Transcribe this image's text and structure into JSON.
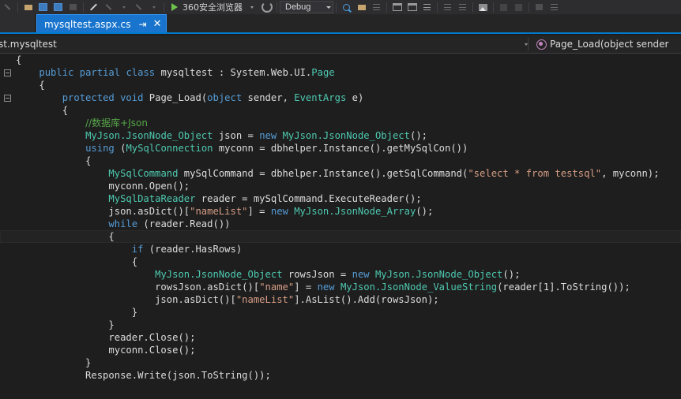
{
  "toolbar": {
    "browser_label": "360安全浏览器",
    "config_label": "Debug",
    "icons": [
      "open-folder-icon",
      "new-window-icon",
      "save-icon",
      "undo-icon",
      "redo-icon",
      "run-icon",
      "stop-icon",
      "find-icon",
      "comment-icon",
      "uncomment-icon",
      "indent-icon",
      "outdent-icon",
      "image-icon",
      "bar-icon",
      "list-icon"
    ]
  },
  "tab": {
    "title": "mysqltest.aspx.cs",
    "pin_glyph": "⇥",
    "close_glyph": "✕"
  },
  "navbar": {
    "left_text": "st.mysqltest",
    "right_text": "Page_Load(object sender"
  },
  "editor": {
    "lines": [
      {
        "indent": 0,
        "fold": null,
        "current": false,
        "tokens": [
          {
            "t": "{",
            "c": "pl"
          }
        ]
      },
      {
        "indent": 0,
        "fold": "minus",
        "current": false,
        "tokens": [
          {
            "t": "    ",
            "c": "pl"
          },
          {
            "t": "public",
            "c": "kw"
          },
          {
            "t": " ",
            "c": "pl"
          },
          {
            "t": "partial",
            "c": "kw"
          },
          {
            "t": " ",
            "c": "pl"
          },
          {
            "t": "class",
            "c": "kw"
          },
          {
            "t": " mysqltest : System.Web.UI.",
            "c": "pl"
          },
          {
            "t": "Page",
            "c": "typ"
          }
        ]
      },
      {
        "indent": 0,
        "fold": null,
        "current": false,
        "tokens": [
          {
            "t": "    {",
            "c": "pl"
          }
        ]
      },
      {
        "indent": 0,
        "fold": "minus",
        "current": false,
        "tokens": [
          {
            "t": "        ",
            "c": "pl"
          },
          {
            "t": "protected",
            "c": "kw"
          },
          {
            "t": " ",
            "c": "pl"
          },
          {
            "t": "void",
            "c": "kw"
          },
          {
            "t": " Page_Load(",
            "c": "pl"
          },
          {
            "t": "object",
            "c": "kw"
          },
          {
            "t": " sender, ",
            "c": "pl"
          },
          {
            "t": "EventArgs",
            "c": "typ"
          },
          {
            "t": " e)",
            "c": "pl"
          }
        ]
      },
      {
        "indent": 0,
        "fold": null,
        "current": false,
        "tokens": [
          {
            "t": "        {",
            "c": "pl"
          }
        ]
      },
      {
        "indent": 0,
        "fold": null,
        "current": false,
        "tokens": [
          {
            "t": "            ",
            "c": "pl"
          },
          {
            "t": "//数据库+Json",
            "c": "cm"
          }
        ]
      },
      {
        "indent": 0,
        "fold": null,
        "current": false,
        "tokens": [
          {
            "t": "            ",
            "c": "pl"
          },
          {
            "t": "MyJson.JsonNode_Object",
            "c": "typ"
          },
          {
            "t": " json = ",
            "c": "pl"
          },
          {
            "t": "new",
            "c": "kw"
          },
          {
            "t": " ",
            "c": "pl"
          },
          {
            "t": "MyJson.JsonNode_Object",
            "c": "typ"
          },
          {
            "t": "();",
            "c": "pl"
          }
        ]
      },
      {
        "indent": 0,
        "fold": null,
        "current": false,
        "tokens": [
          {
            "t": "            ",
            "c": "pl"
          },
          {
            "t": "using",
            "c": "kw"
          },
          {
            "t": " (",
            "c": "pl"
          },
          {
            "t": "MySqlConnection",
            "c": "typ"
          },
          {
            "t": " myconn = dbhelper.Instance().getMySqlCon())",
            "c": "pl"
          }
        ]
      },
      {
        "indent": 0,
        "fold": null,
        "current": false,
        "tokens": [
          {
            "t": "            {",
            "c": "pl"
          }
        ]
      },
      {
        "indent": 0,
        "fold": null,
        "current": false,
        "tokens": [
          {
            "t": "                ",
            "c": "pl"
          },
          {
            "t": "MySqlCommand",
            "c": "typ"
          },
          {
            "t": " mySqlCommand = dbhelper.Instance().getSqlCommand(",
            "c": "pl"
          },
          {
            "t": "\"select * from testsql\"",
            "c": "str"
          },
          {
            "t": ", myconn);",
            "c": "pl"
          }
        ]
      },
      {
        "indent": 0,
        "fold": null,
        "current": false,
        "tokens": [
          {
            "t": "                myconn.Open();",
            "c": "pl"
          }
        ]
      },
      {
        "indent": 0,
        "fold": null,
        "current": false,
        "tokens": [
          {
            "t": "                ",
            "c": "pl"
          },
          {
            "t": "MySqlDataReader",
            "c": "typ"
          },
          {
            "t": " reader = mySqlCommand.ExecuteReader();",
            "c": "pl"
          }
        ]
      },
      {
        "indent": 0,
        "fold": null,
        "current": false,
        "tokens": [
          {
            "t": "                json.asDict()[",
            "c": "pl"
          },
          {
            "t": "\"nameList\"",
            "c": "str"
          },
          {
            "t": "] = ",
            "c": "pl"
          },
          {
            "t": "new",
            "c": "kw"
          },
          {
            "t": " ",
            "c": "pl"
          },
          {
            "t": "MyJson.JsonNode_Array",
            "c": "typ"
          },
          {
            "t": "();",
            "c": "pl"
          }
        ]
      },
      {
        "indent": 0,
        "fold": null,
        "current": false,
        "tokens": [
          {
            "t": "                ",
            "c": "pl"
          },
          {
            "t": "while",
            "c": "kw"
          },
          {
            "t": " (reader.Read())",
            "c": "pl"
          }
        ]
      },
      {
        "indent": 0,
        "fold": null,
        "current": true,
        "tokens": [
          {
            "t": "                {",
            "c": "pl"
          }
        ]
      },
      {
        "indent": 0,
        "fold": null,
        "current": false,
        "tokens": [
          {
            "t": "                    ",
            "c": "pl"
          },
          {
            "t": "if",
            "c": "kw"
          },
          {
            "t": " (reader.HasRows)",
            "c": "pl"
          }
        ]
      },
      {
        "indent": 0,
        "fold": null,
        "current": false,
        "tokens": [
          {
            "t": "                    {",
            "c": "pl"
          }
        ]
      },
      {
        "indent": 0,
        "fold": null,
        "current": false,
        "tokens": [
          {
            "t": "                        ",
            "c": "pl"
          },
          {
            "t": "MyJson.JsonNode_Object",
            "c": "typ"
          },
          {
            "t": " rowsJson = ",
            "c": "pl"
          },
          {
            "t": "new",
            "c": "kw"
          },
          {
            "t": " ",
            "c": "pl"
          },
          {
            "t": "MyJson.JsonNode_Object",
            "c": "typ"
          },
          {
            "t": "();",
            "c": "pl"
          }
        ]
      },
      {
        "indent": 0,
        "fold": null,
        "current": false,
        "tokens": [
          {
            "t": "                        rowsJson.asDict()[",
            "c": "pl"
          },
          {
            "t": "\"name\"",
            "c": "str"
          },
          {
            "t": "] = ",
            "c": "pl"
          },
          {
            "t": "new",
            "c": "kw"
          },
          {
            "t": " ",
            "c": "pl"
          },
          {
            "t": "MyJson.JsonNode_ValueString",
            "c": "typ"
          },
          {
            "t": "(reader[1].ToString());",
            "c": "pl"
          }
        ]
      },
      {
        "indent": 0,
        "fold": null,
        "current": false,
        "tokens": [
          {
            "t": "                        json.asDict()[",
            "c": "pl"
          },
          {
            "t": "\"nameList\"",
            "c": "str"
          },
          {
            "t": "].AsList().Add(rowsJson);",
            "c": "pl"
          }
        ]
      },
      {
        "indent": 0,
        "fold": null,
        "current": false,
        "tokens": [
          {
            "t": "                    }",
            "c": "pl"
          }
        ]
      },
      {
        "indent": 0,
        "fold": null,
        "current": false,
        "tokens": [
          {
            "t": "                }",
            "c": "pl"
          }
        ]
      },
      {
        "indent": 0,
        "fold": null,
        "current": false,
        "tokens": [
          {
            "t": "                reader.Close();",
            "c": "pl"
          }
        ]
      },
      {
        "indent": 0,
        "fold": null,
        "current": false,
        "tokens": [
          {
            "t": "                myconn.Close();",
            "c": "pl"
          }
        ]
      },
      {
        "indent": 0,
        "fold": null,
        "current": false,
        "tokens": [
          {
            "t": "            }",
            "c": "pl"
          }
        ]
      },
      {
        "indent": 0,
        "fold": null,
        "current": false,
        "tokens": [
          {
            "t": "            Response.Write(json.ToString());",
            "c": "pl"
          }
        ]
      }
    ]
  },
  "colors": {
    "editor_bg": "#1e1e1e",
    "chrome_bg": "#2d2d30",
    "tab_active": "#1874cd",
    "accent": "#007acc",
    "keyword": "#569cd6",
    "type": "#4ec9b0",
    "string": "#d69d85",
    "comment": "#57a64a",
    "text": "#dcdcdc"
  }
}
